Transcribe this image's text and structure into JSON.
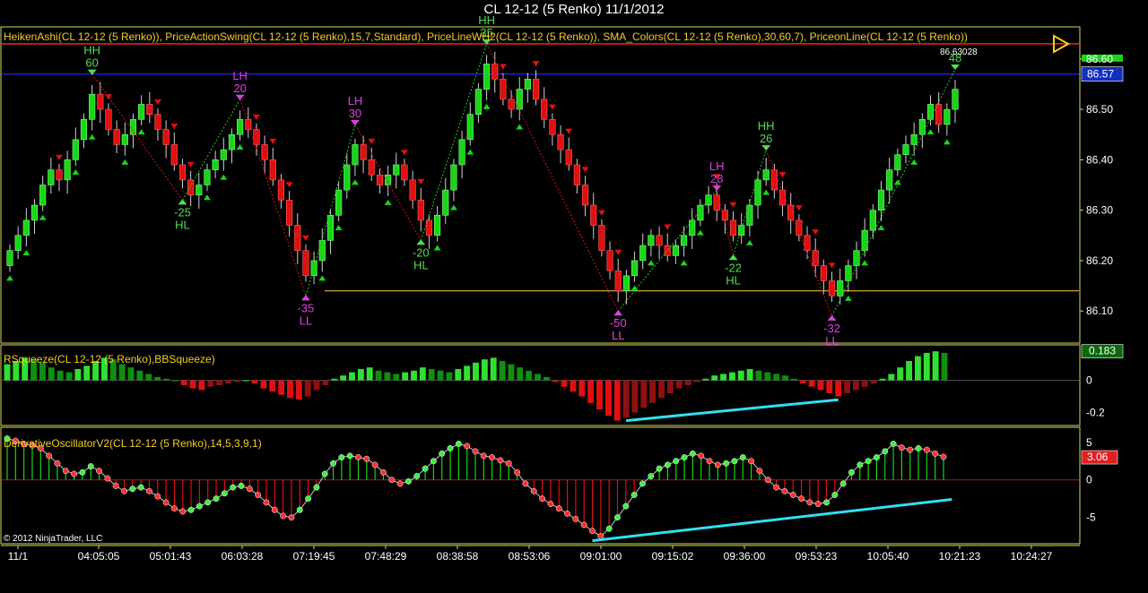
{
  "title": "CL 12-12 (5 Renko)  11/1/2012",
  "copyright": "© 2012 NinjaTrader, LLC",
  "colors": {
    "up": "#19d419",
    "down": "#e01010",
    "frame": "#d8d860",
    "red_line": "#ff2020",
    "blue_line": "#2020ff",
    "gold_line": "#e8b830",
    "divergence": "#30e0f0",
    "swing_high": "#50e050",
    "swing_low": "#e040e0"
  },
  "chart_data": [
    {
      "type": "candlestick",
      "pane": "price",
      "label": "HeikenAshi(CL 12-12 (5 Renko)),  PriceActionSwing(CL 12-12 (5 Renko),15,7,Standard),  PriceLineWH2(CL 12-12 (5 Renko)),  SMA_Colors(CL 12-12 (5 Renko),30,60,7),  PriceonLine(CL 12-12 (5 Renko))",
      "ylim": [
        86.04,
        86.66
      ],
      "yticks": [
        "86.10",
        "86.20",
        "86.30",
        "86.40",
        "86.50",
        "86.60"
      ],
      "last_price": "86.57",
      "price_line_label": "86.63028",
      "levels": [
        86.63,
        86.57,
        86.14
      ],
      "closes": [
        86.22,
        86.25,
        86.28,
        86.31,
        86.35,
        86.38,
        86.36,
        86.4,
        86.44,
        86.48,
        86.53,
        86.5,
        86.46,
        86.43,
        86.45,
        86.48,
        86.51,
        86.49,
        86.46,
        86.43,
        86.39,
        86.36,
        86.33,
        86.35,
        86.38,
        86.4,
        86.42,
        86.45,
        86.48,
        86.46,
        86.43,
        86.4,
        86.36,
        86.32,
        86.27,
        86.22,
        86.17,
        86.2,
        86.24,
        86.29,
        86.34,
        86.39,
        86.43,
        86.4,
        86.37,
        86.35,
        86.37,
        86.39,
        86.36,
        86.32,
        86.28,
        86.25,
        86.29,
        86.34,
        86.39,
        86.44,
        86.49,
        86.54,
        86.59,
        86.56,
        86.52,
        86.5,
        86.54,
        86.56,
        86.52,
        86.48,
        86.45,
        86.42,
        86.39,
        86.35,
        86.31,
        86.27,
        86.22,
        86.18,
        86.14,
        86.17,
        86.2,
        86.23,
        86.25,
        86.23,
        86.21,
        86.23,
        86.25,
        86.28,
        86.31,
        86.33,
        86.3,
        86.28,
        86.25,
        86.27,
        86.31,
        86.36,
        86.38,
        86.34,
        86.31,
        86.28,
        86.25,
        86.22,
        86.19,
        86.16,
        86.13,
        86.16,
        86.19,
        86.22,
        86.26,
        86.3,
        86.34,
        86.38,
        86.41,
        86.43,
        86.45,
        86.48,
        86.51,
        86.47,
        86.5,
        86.54
      ]
    },
    {
      "type": "bar",
      "pane": "rsqueeze",
      "label": "RSqueeze(CL 12-12 (5 Renko),BBSqueeze)",
      "ylim": [
        -0.28,
        0.22
      ],
      "yticks": [
        "0",
        "-0.2"
      ],
      "last_value": "0.183",
      "values": [
        0.1,
        0.12,
        0.14,
        0.13,
        0.11,
        0.08,
        0.06,
        0.05,
        0.07,
        0.09,
        0.12,
        0.14,
        0.13,
        0.1,
        0.08,
        0.06,
        0.04,
        0.02,
        0.01,
        0.0,
        -0.03,
        -0.05,
        -0.06,
        -0.04,
        -0.03,
        -0.02,
        -0.01,
        0.0,
        -0.02,
        -0.05,
        -0.07,
        -0.09,
        -0.11,
        -0.12,
        -0.1,
        -0.06,
        -0.03,
        0.01,
        0.03,
        0.05,
        0.07,
        0.08,
        0.06,
        0.05,
        0.04,
        0.05,
        0.06,
        0.08,
        0.07,
        0.06,
        0.05,
        0.07,
        0.09,
        0.11,
        0.13,
        0.14,
        0.12,
        0.1,
        0.08,
        0.06,
        0.04,
        0.02,
        -0.01,
        -0.04,
        -0.07,
        -0.1,
        -0.14,
        -0.18,
        -0.22,
        -0.25,
        -0.23,
        -0.2,
        -0.17,
        -0.14,
        -0.11,
        -0.08,
        -0.05,
        -0.03,
        -0.01,
        0.01,
        0.03,
        0.04,
        0.05,
        0.06,
        0.07,
        0.06,
        0.05,
        0.04,
        0.03,
        0.01,
        -0.02,
        -0.04,
        -0.06,
        -0.08,
        -0.1,
        -0.08,
        -0.06,
        -0.04,
        -0.02,
        0.01,
        0.04,
        0.08,
        0.12,
        0.15,
        0.17,
        0.18,
        0.17
      ],
      "trendline": [
        [
          -0.25,
          70
        ],
        [
          -0.12,
          94
        ]
      ]
    },
    {
      "type": "line",
      "pane": "derivative",
      "label": "DerivativeOscillatorV2(CL 12-12 (5 Renko),14,5,3,9,1)",
      "ylim": [
        -8.5,
        7
      ],
      "yticks": [
        "5",
        "0",
        "-5"
      ],
      "last_value": "3.06",
      "values": [
        5.5,
        5.2,
        4.8,
        4.6,
        4.2,
        3.2,
        2.2,
        1.2,
        0.8,
        1.0,
        1.8,
        1.2,
        0.2,
        -0.8,
        -1.5,
        -1.2,
        -1.0,
        -1.5,
        -2.2,
        -3.0,
        -3.8,
        -4.2,
        -4.0,
        -3.5,
        -3.0,
        -2.5,
        -1.8,
        -1.0,
        -0.8,
        -1.2,
        -2.0,
        -3.0,
        -4.0,
        -4.8,
        -5.0,
        -4.0,
        -2.5,
        -1.0,
        0.8,
        2.2,
        3.0,
        3.2,
        3.0,
        2.8,
        2.0,
        1.0,
        0.0,
        -0.5,
        -0.2,
        0.5,
        1.5,
        2.5,
        3.5,
        4.2,
        4.8,
        4.5,
        3.8,
        3.2,
        3.0,
        2.6,
        2.2,
        1.0,
        -0.5,
        -1.5,
        -2.5,
        -3.2,
        -3.8,
        -4.5,
        -5.2,
        -6.0,
        -6.8,
        -7.5,
        -6.5,
        -5.0,
        -3.5,
        -2.0,
        -0.5,
        0.5,
        1.5,
        2.0,
        2.5,
        3.0,
        3.5,
        3.2,
        2.5,
        2.0,
        2.2,
        2.5,
        3.0,
        2.5,
        1.2,
        0.0,
        -1.0,
        -1.5,
        -2.0,
        -2.5,
        -3.0,
        -3.2,
        -3.0,
        -2.0,
        -0.5,
        1.0,
        2.0,
        2.5,
        3.0,
        3.8,
        4.8,
        4.3,
        4.0,
        4.2,
        4.0,
        3.5,
        3.06
      ],
      "trendline": [
        [
          -8.1,
          70
        ],
        [
          -2.6,
          113
        ]
      ]
    }
  ],
  "swings": [
    {
      "label": "HH",
      "value": "60",
      "kind": "high",
      "bar": 10
    },
    {
      "label": "HL",
      "value": "-25",
      "kind": "low",
      "bar": 21
    },
    {
      "label": "LH",
      "value": "20",
      "kind": "high",
      "bar": 28
    },
    {
      "label": "LL",
      "value": "-35",
      "kind": "low",
      "bar": 36
    },
    {
      "label": "LH",
      "value": "30",
      "kind": "high",
      "bar": 42
    },
    {
      "label": "HL",
      "value": "-20",
      "kind": "low",
      "bar": 50
    },
    {
      "label": "HH",
      "value": "35",
      "kind": "high",
      "bar": 58
    },
    {
      "label": "LL",
      "value": "-50",
      "kind": "low",
      "bar": 74
    },
    {
      "label": "LH",
      "value": "28",
      "kind": "high",
      "bar": 86
    },
    {
      "label": "HL",
      "value": "-22",
      "kind": "low",
      "bar": 88
    },
    {
      "label": "HH",
      "value": "26",
      "kind": "high",
      "bar": 92
    },
    {
      "label": "LL",
      "value": "-32",
      "kind": "low",
      "bar": 100
    },
    {
      "label": "",
      "value": "48",
      "kind": "high",
      "bar": 115
    }
  ],
  "time_labels": [
    "11/1",
    "04:05:05",
    "05:01:43",
    "06:03:28",
    "07:19:45",
    "07:48:29",
    "08:38:58",
    "08:53:06",
    "09:01:00",
    "09:15:02",
    "09:36:00",
    "09:53:23",
    "10:05:40",
    "10:21:23",
    "10:24:27"
  ]
}
